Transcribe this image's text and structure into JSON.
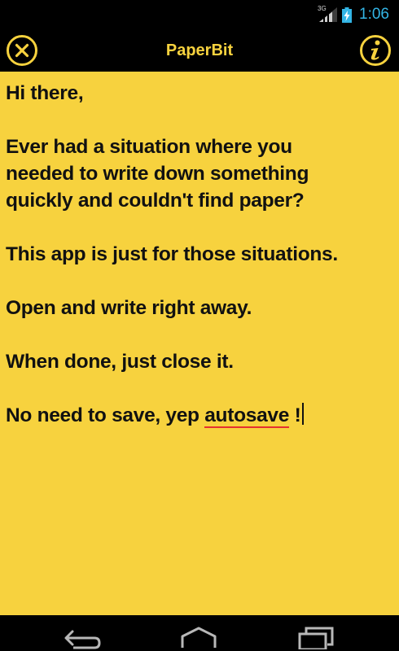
{
  "status_bar": {
    "network_type": "3G",
    "time": "1:06",
    "icons": [
      "signal-icon",
      "battery-icon"
    ]
  },
  "action_bar": {
    "title": "PaperBit",
    "left_icon": "close-icon",
    "right_icon": "info-icon"
  },
  "note": {
    "paragraphs": [
      {
        "lines": [
          "Hi there,"
        ]
      },
      {
        "lines": [
          "Ever had a situation where you",
          "needed to write down something",
          "quickly and couldn't find paper?"
        ]
      },
      {
        "lines": [
          "This app is just for those situations."
        ]
      },
      {
        "lines": [
          "Open and write right away."
        ]
      },
      {
        "lines": [
          "When done, just close it."
        ]
      }
    ],
    "last_line": {
      "before": "No need to save, yep ",
      "misspelled_word": "autosave",
      "after": " !"
    }
  },
  "nav_bar": {
    "icons": [
      "back-icon",
      "home-icon",
      "recent-apps-icon"
    ]
  },
  "colors": {
    "paper": "#f7d23e",
    "bar_background": "#000000",
    "accent_title": "#f7d23e",
    "clock": "#33b5e5",
    "spellcheck_underline": "#e53030"
  }
}
